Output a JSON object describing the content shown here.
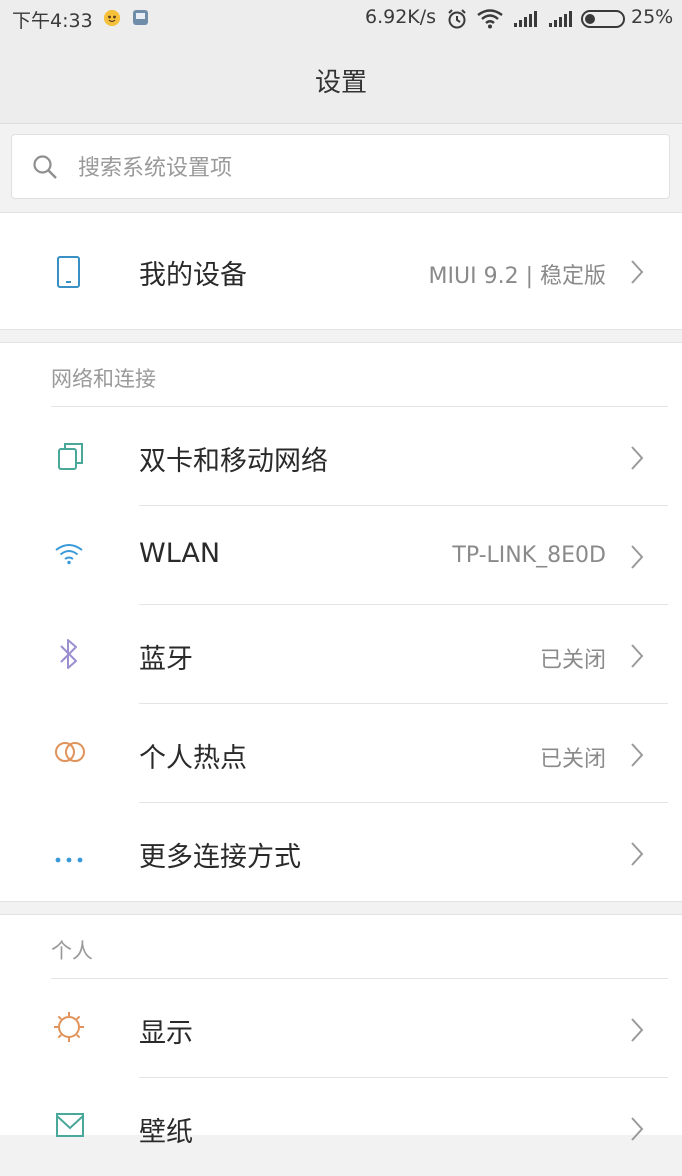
{
  "status_bar": {
    "time": "下午4:33",
    "net_speed": "6.92K/s",
    "battery_pct": "25%",
    "battery_level": 0.25,
    "icons": [
      "notification-app-icon",
      "notification-square-icon",
      "alarm-icon",
      "wifi-icon",
      "signal-icon",
      "signal-icon",
      "battery-icon"
    ]
  },
  "header": {
    "title": "设置"
  },
  "search": {
    "placeholder": "搜索系统设置项",
    "value": ""
  },
  "my_device": {
    "label": "我的设备",
    "value": "MIUI 9.2 | 稳定版",
    "icon": "phone-icon"
  },
  "network_section": {
    "header": "网络和连接",
    "items": [
      {
        "label": "双卡和移动网络",
        "value": "",
        "icon": "dual-sim-icon",
        "color": "#4aa89a"
      },
      {
        "label": "WLAN",
        "value": "TP-LINK_8E0D",
        "icon": "wifi-icon",
        "color": "#3a9ad9"
      },
      {
        "label": "蓝牙",
        "value": "已关闭",
        "icon": "bluetooth-icon",
        "color": "#9b8fd0"
      },
      {
        "label": "个人热点",
        "value": "已关闭",
        "icon": "hotspot-icon",
        "color": "#e0935a"
      },
      {
        "label": "更多连接方式",
        "value": "",
        "icon": "more-dots-icon",
        "color": "#3a9ad9"
      }
    ]
  },
  "personal_section": {
    "header": "个人",
    "items": [
      {
        "label": "显示",
        "value": "",
        "icon": "brightness-icon",
        "color": "#e0935a"
      },
      {
        "label": "壁纸",
        "value": "",
        "icon": "wallpaper-icon",
        "color": "#4aa89a"
      }
    ]
  },
  "colors": {
    "background": "#f2f2f2",
    "card": "#ffffff",
    "secondary_text": "#8a8a8a"
  }
}
